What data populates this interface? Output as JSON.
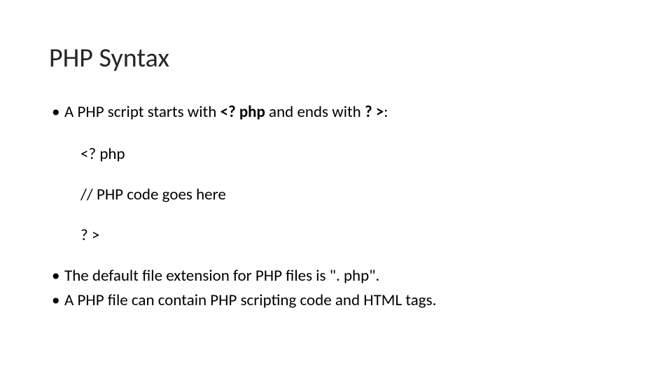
{
  "title": "PHP Syntax",
  "bullet1_prefix": "A PHP script starts with ",
  "bullet1_bold1": "<? php",
  "bullet1_mid": " and ends with ",
  "bullet1_bold2": "? >",
  "bullet1_suffix": ":",
  "code_line1": "<? php",
  "code_line2": "// PHP code goes here",
  "code_line3": "? >",
  "bullet2": "The default file extension for PHP files is \". php\".",
  "bullet3": "A PHP file can contain PHP scripting code and HTML tags."
}
